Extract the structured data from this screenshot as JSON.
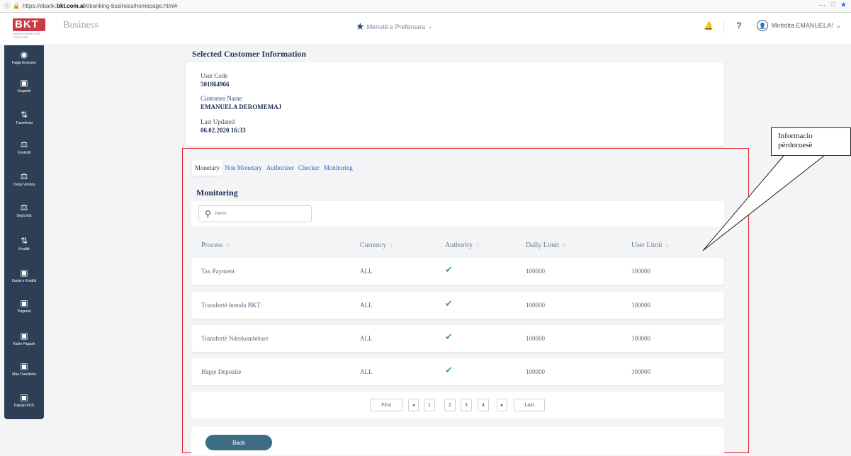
{
  "browser": {
    "url_prefix": "https://ebank.",
    "url_domain": "bkt.com.al",
    "url_path": "/ebanking-business/homepage.html#",
    "menu_icon": "ellipsis-icon",
    "pocket_icon": "pocket-icon",
    "bookmark_icon": "star-icon"
  },
  "header": {
    "logo_text": "BKT",
    "logo_tagline": "BANKA KOMBETARE TREGTARE",
    "brand_sub": "Business",
    "favorites_label": "Menutë e Preferuara",
    "help_label": "?",
    "user_greeting": "Mirëdita EMANUELA!",
    "accent": "#2d3f55"
  },
  "sidebar": {
    "items": [
      {
        "label": "Faqja Kryesore",
        "icon": "home-icon"
      },
      {
        "label": "Llogaritë",
        "icon": "accounts-icon"
      },
      {
        "label": "Transfertat",
        "icon": "transfer-icon"
      },
      {
        "label": "Kontrolli",
        "icon": "control-icon"
      },
      {
        "label": "Tregu Vendas",
        "icon": "market-icon"
      },
      {
        "label": "Depozitat",
        "icon": "deposit-icon"
      },
      {
        "label": "Kreditë",
        "icon": "credit-icon"
      },
      {
        "label": "Kartat e Kreditit",
        "icon": "card-icon"
      },
      {
        "label": "Pagesat",
        "icon": "payment-icon"
      },
      {
        "label": "Kalim Pagash",
        "icon": "payroll-icon"
      },
      {
        "label": "Mas-Transferta",
        "icon": "mass-transfer-icon"
      },
      {
        "label": "Pajisjet POS",
        "icon": "pos-icon"
      }
    ]
  },
  "customer": {
    "section_title": "Selected Customer Information",
    "user_code_label": "User Code",
    "user_code": "501864966",
    "name_label": "Customer Name",
    "name": "EMANUELA DEROMEMAJ",
    "updated_label": "Last Updated",
    "updated": "06.02.2020 16:33"
  },
  "tabs": [
    {
      "label": "Monetary",
      "active": true
    },
    {
      "label": "Non Monetary",
      "active": false
    },
    {
      "label": "Authorizer",
      "active": false
    },
    {
      "label": "Checker",
      "active": false
    },
    {
      "label": "Monitoring",
      "active": false
    }
  ],
  "monitoring": {
    "heading": "Monitoring",
    "search_placeholder": "Kërko",
    "columns": [
      "Process",
      "Currency",
      "Authority",
      "Daily Limit",
      "User Limit"
    ],
    "rows": [
      {
        "process": "Tax Payment",
        "currency": "ALL",
        "authority": "✔",
        "daily": "100000",
        "user": "100000"
      },
      {
        "process": "Transfertë brenda BKT",
        "currency": "ALL",
        "authority": "✔",
        "daily": "100000",
        "user": "100000"
      },
      {
        "process": "Transfertë Nderkombëtare",
        "currency": "ALL",
        "authority": "✔",
        "daily": "100000",
        "user": "100000"
      },
      {
        "process": "Hapje Depozite",
        "currency": "ALL",
        "authority": "✔",
        "daily": "100000",
        "user": "100000"
      }
    ]
  },
  "pager": {
    "first": "First",
    "prev": "◂",
    "pages": [
      "1",
      "2",
      "3",
      "4"
    ],
    "next": "▸",
    "last": "Last"
  },
  "back_label": "Back",
  "callout": {
    "line1": "Informacio",
    "line2": "përdoruesë"
  }
}
